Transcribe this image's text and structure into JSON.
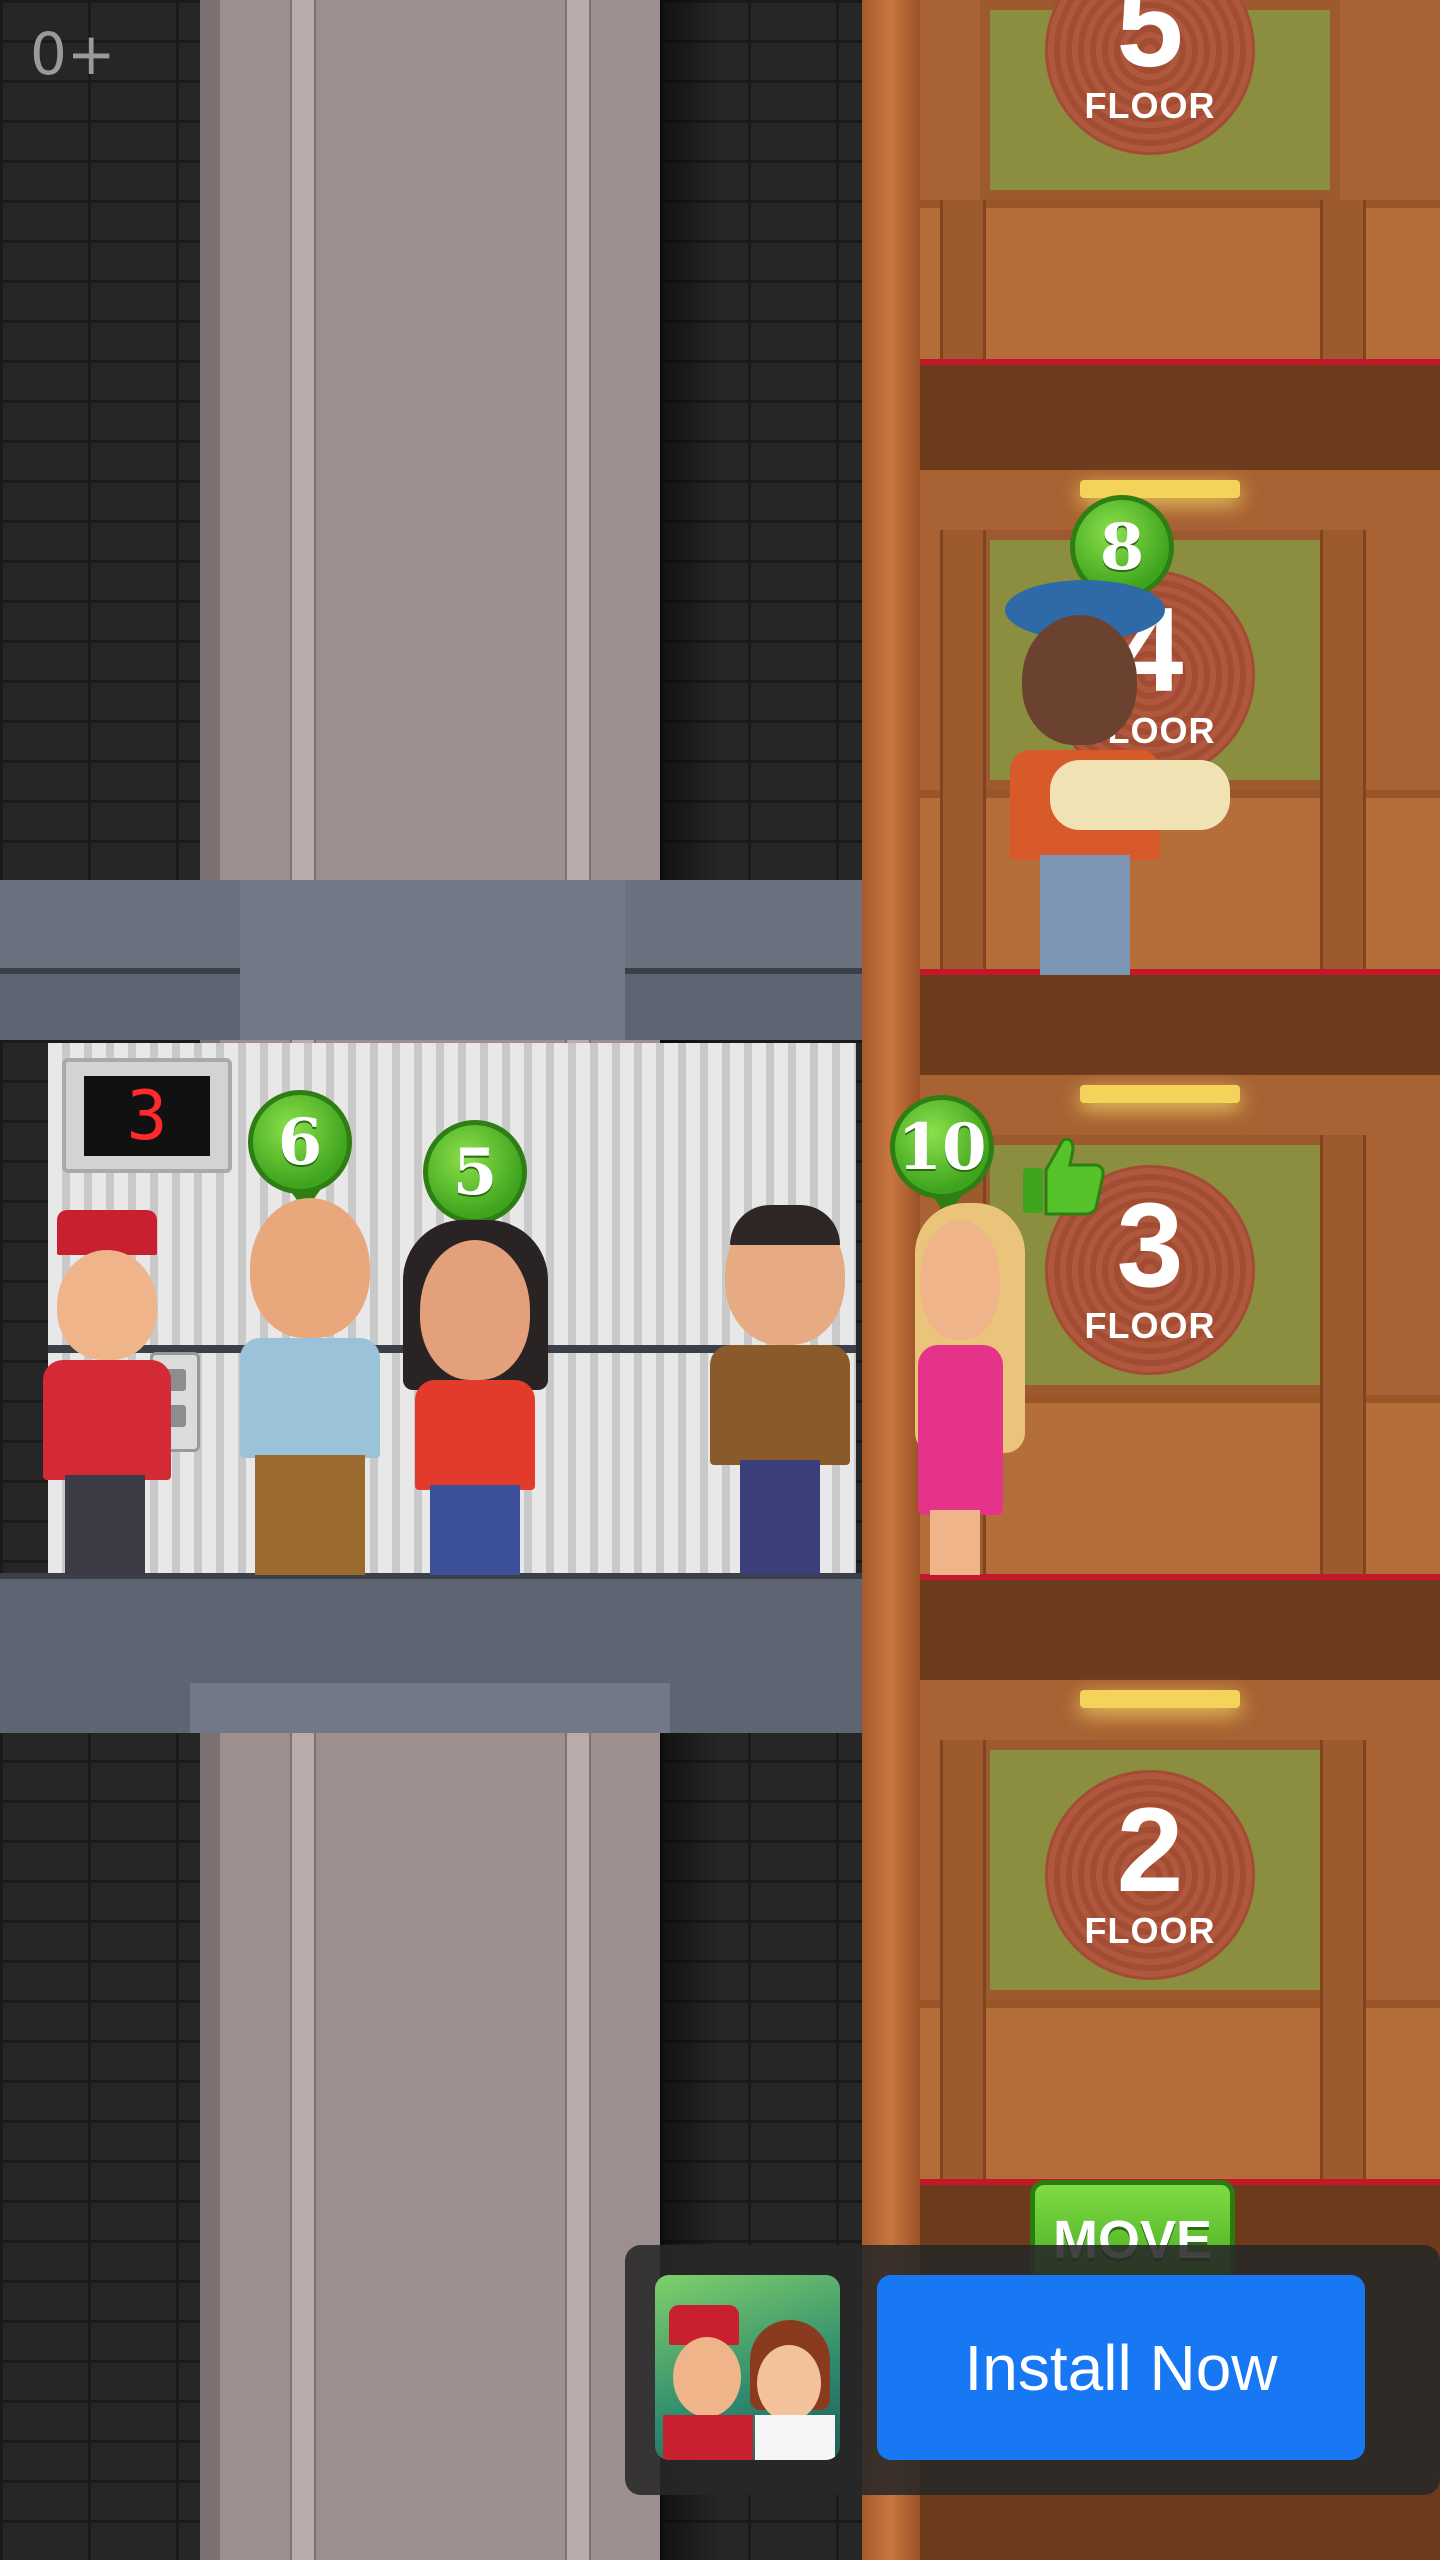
{
  "hud": {
    "age_rating": "0+"
  },
  "elevator": {
    "current_floor": "3",
    "passengers": [
      {
        "name": "bellhop",
        "target_floor": ""
      },
      {
        "name": "man-with-suspenders",
        "target_floor": "6"
      },
      {
        "name": "woman-red-top",
        "target_floor": "5"
      },
      {
        "name": "man-brown-jacket",
        "target_floor": ""
      }
    ]
  },
  "floors": [
    {
      "number": "5",
      "label": "FLOOR"
    },
    {
      "number": "4",
      "label": "FLOOR"
    },
    {
      "number": "3",
      "label": "FLOOR"
    },
    {
      "number": "2",
      "label": "FLOOR"
    }
  ],
  "waiting": [
    {
      "floor": "4",
      "name": "old-man-with-scrolls",
      "target_floor": "8"
    },
    {
      "floor": "3",
      "name": "blonde-woman",
      "target_floor": "10"
    }
  ],
  "controls": {
    "move_label": "MOVE"
  },
  "ad": {
    "install_label": "Install Now"
  },
  "colors": {
    "install_button": "#1877f2",
    "bubble_green": "#3ea41d",
    "wood": "#a86233"
  }
}
